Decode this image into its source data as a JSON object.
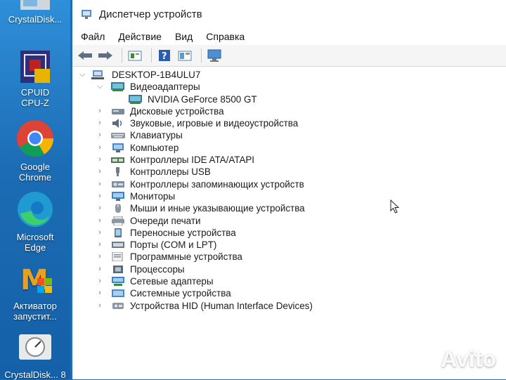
{
  "desktop": {
    "icons": [
      {
        "name": "crystaldiskinfo",
        "label": "CrystalDisk..."
      },
      {
        "name": "cpuz",
        "label": "CPUID CPU-Z"
      },
      {
        "name": "chrome",
        "label": "Google Chrome"
      },
      {
        "name": "edge",
        "label": "Microsoft Edge"
      },
      {
        "name": "activator",
        "label": "Активатор запустит..."
      },
      {
        "name": "crystaldiskmark",
        "label": "CrystalDisk... 8"
      }
    ]
  },
  "window": {
    "title": "Диспетчер устройств",
    "menu": [
      "Файл",
      "Действие",
      "Вид",
      "Справка"
    ]
  },
  "tree": {
    "root": "DESKTOP-1B4ULU7",
    "display_adapters": "Видеоадаптеры",
    "gpu": "NVIDIA GeForce 8500 GT",
    "categories": [
      "Дисковые устройства",
      "Звуковые, игровые и видеоустройства",
      "Клавиатуры",
      "Компьютер",
      "Контроллеры IDE ATA/ATAPI",
      "Контроллеры USB",
      "Контроллеры запоминающих устройств",
      "Мониторы",
      "Мыши и иные указывающие устройства",
      "Очереди печати",
      "Переносные устройства",
      "Порты (COM и LPT)",
      "Программные устройства",
      "Процессоры",
      "Сетевые адаптеры",
      "Системные устройства",
      "Устройства HID (Human Interface Devices)"
    ]
  },
  "watermark": "Avito"
}
